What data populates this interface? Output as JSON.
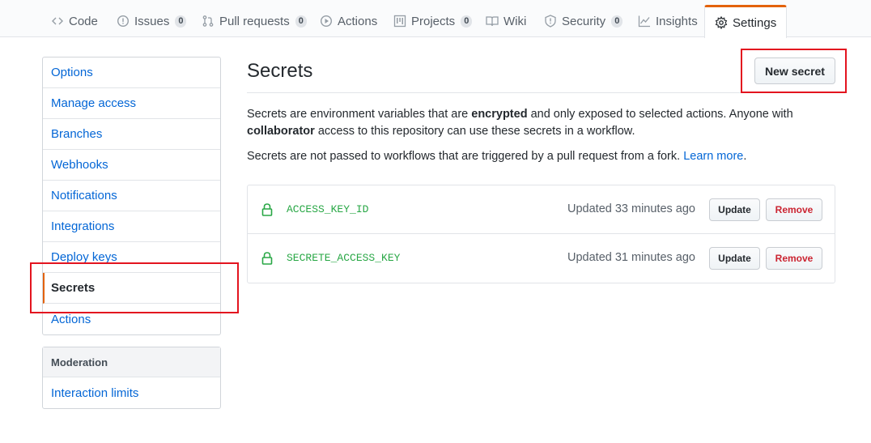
{
  "tabs": [
    {
      "label": "Code",
      "icon": "code-icon"
    },
    {
      "label": "Issues",
      "icon": "issue-icon",
      "count": "0"
    },
    {
      "label": "Pull requests",
      "icon": "pull-request-icon",
      "count": "0"
    },
    {
      "label": "Actions",
      "icon": "play-icon"
    },
    {
      "label": "Projects",
      "icon": "project-icon",
      "count": "0"
    },
    {
      "label": "Wiki",
      "icon": "book-icon"
    },
    {
      "label": "Security",
      "icon": "shield-icon",
      "count": "0"
    },
    {
      "label": "Insights",
      "icon": "graph-icon"
    },
    {
      "label": "Settings",
      "icon": "gear-icon",
      "selected": true
    }
  ],
  "sidebar": {
    "items": [
      {
        "label": "Options"
      },
      {
        "label": "Manage access"
      },
      {
        "label": "Branches"
      },
      {
        "label": "Webhooks"
      },
      {
        "label": "Notifications"
      },
      {
        "label": "Integrations"
      },
      {
        "label": "Deploy keys"
      },
      {
        "label": "Secrets",
        "selected": true
      },
      {
        "label": "Actions"
      }
    ],
    "moderation": {
      "heading": "Moderation",
      "items": [
        {
          "label": "Interaction limits"
        }
      ]
    }
  },
  "main": {
    "title": "Secrets",
    "new_secret_label": "New secret",
    "desc1": {
      "part1": "Secrets are environment variables that are ",
      "bold1": "encrypted",
      "part2": " and only exposed to selected actions. Anyone with ",
      "bold2": "collaborator",
      "part3": " access to this repository can use these secrets in a workflow."
    },
    "desc2": {
      "text": "Secrets are not passed to workflows that are triggered by a pull request from a fork. ",
      "link": "Learn more",
      "end": "."
    },
    "secrets": [
      {
        "name": "ACCESS_KEY_ID",
        "updated": "Updated 33 minutes ago",
        "update_label": "Update",
        "remove_label": "Remove"
      },
      {
        "name": "SECRETE_ACCESS_KEY",
        "updated": "Updated 31 minutes ago",
        "update_label": "Update",
        "remove_label": "Remove"
      }
    ]
  },
  "colors": {
    "accent": "#e36209",
    "link": "#0366d6",
    "secret_green": "#28a745",
    "danger": "#cb2431",
    "annotation_red": "#e3141f"
  }
}
